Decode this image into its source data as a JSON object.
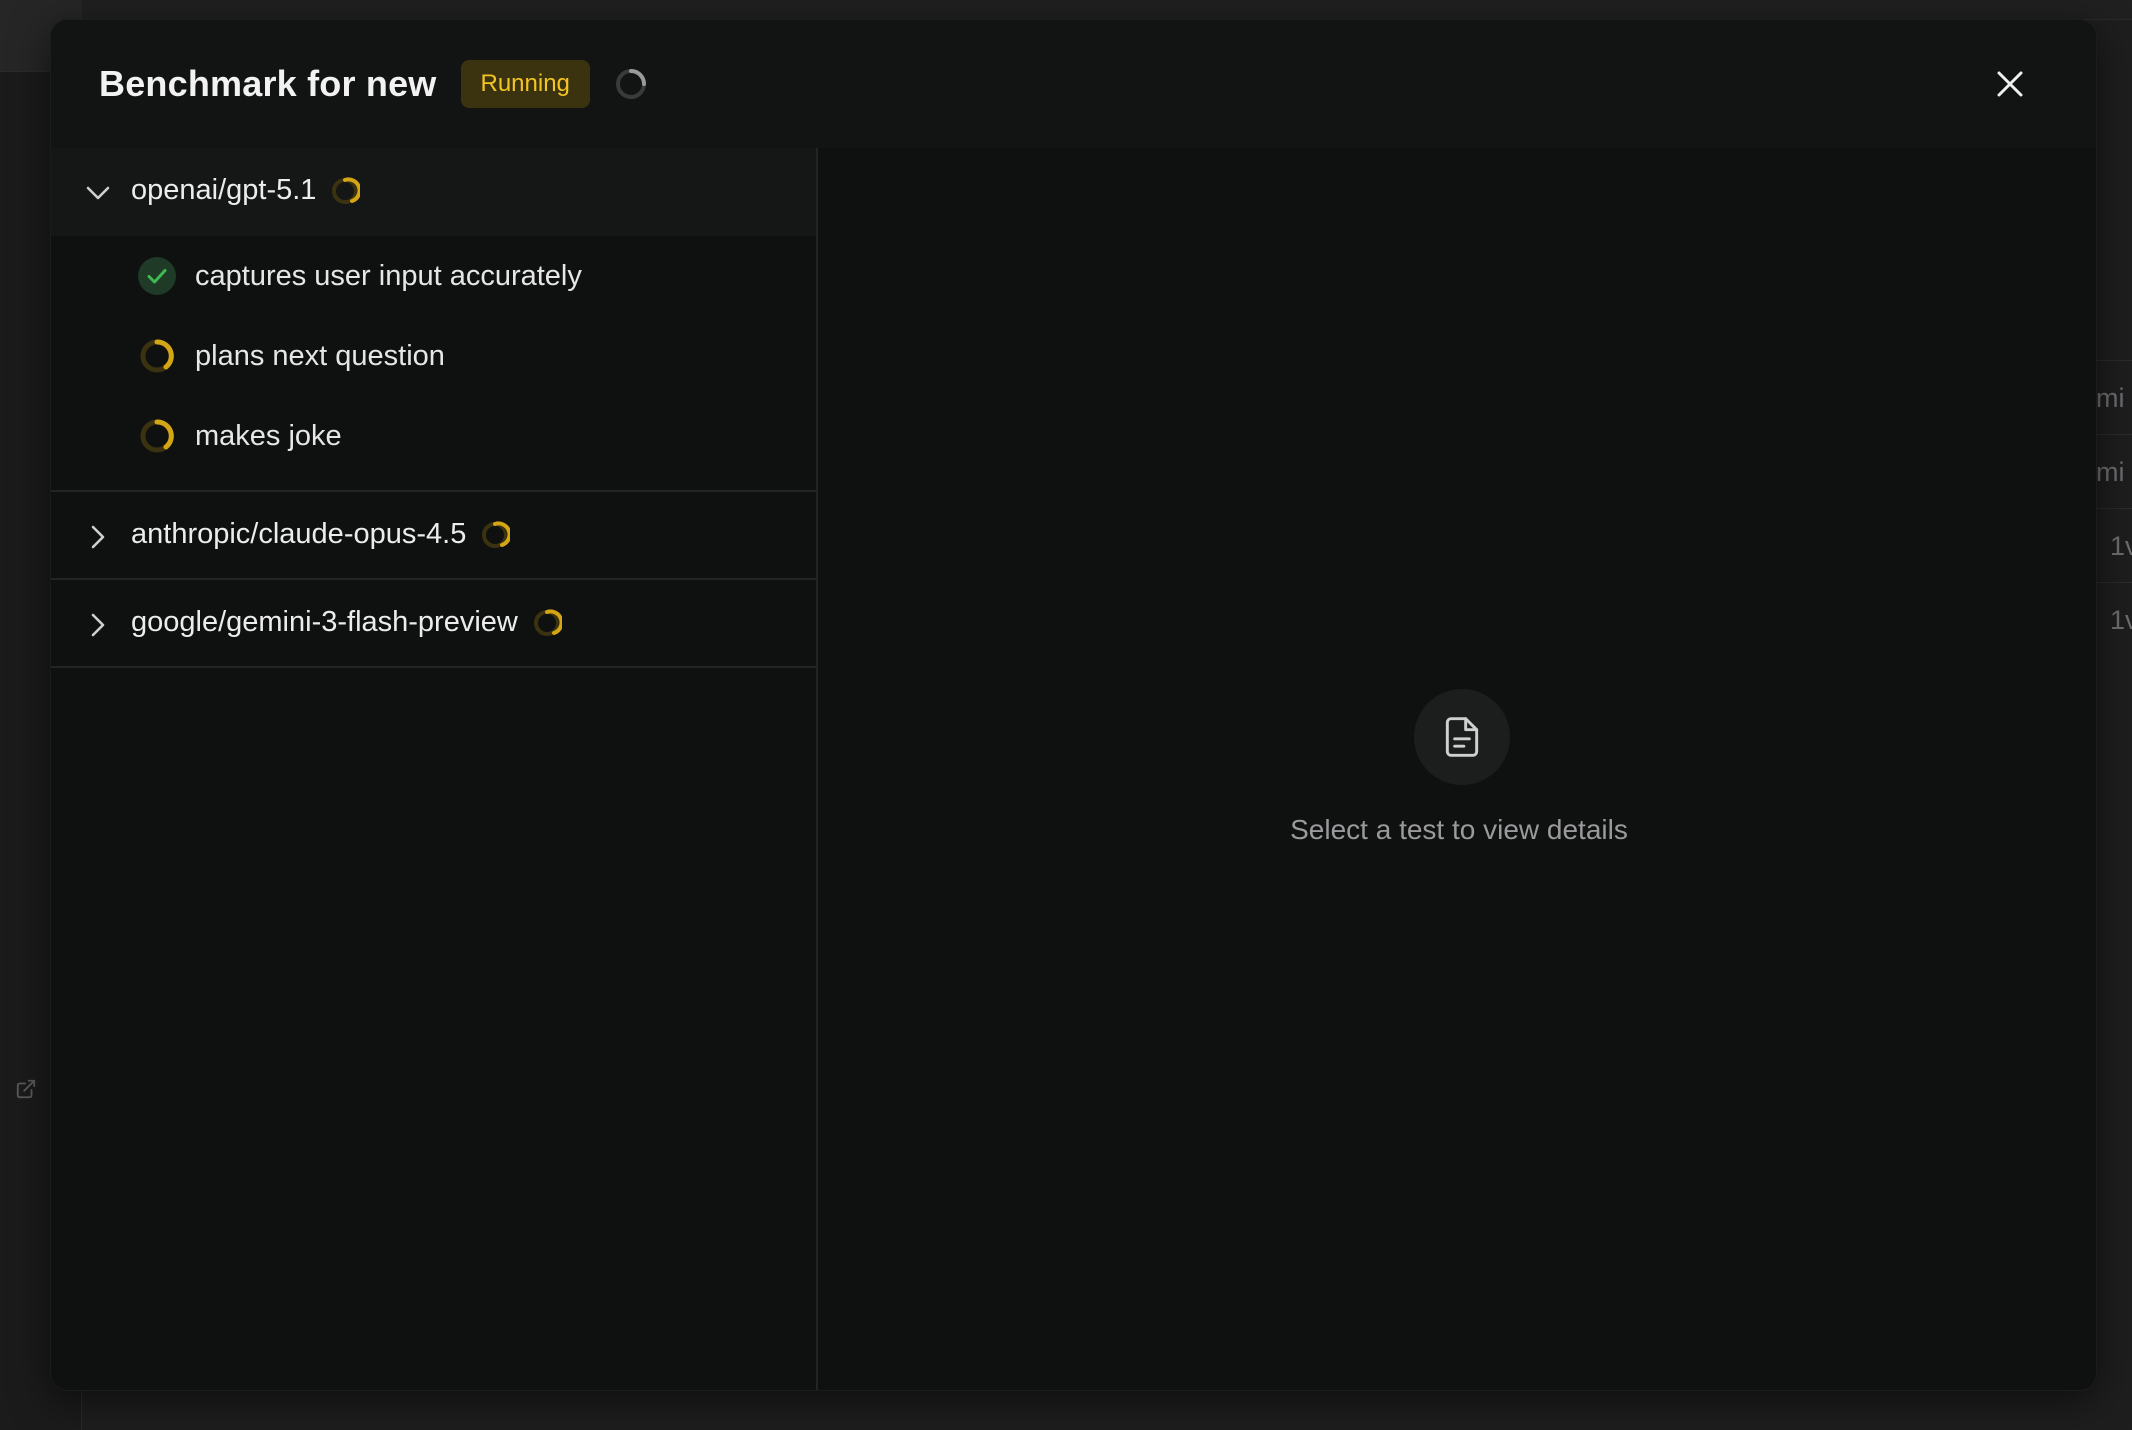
{
  "modal": {
    "title": "Benchmark for new",
    "status_badge": "Running",
    "close_icon": "close-icon"
  },
  "models": [
    {
      "name": "openai/gpt-5.1",
      "expanded": true,
      "status": "running",
      "tests": [
        {
          "label": "captures user input accurately",
          "status": "passed"
        },
        {
          "label": "plans next question",
          "status": "running"
        },
        {
          "label": "makes joke",
          "status": "running"
        }
      ]
    },
    {
      "name": "anthropic/claude-opus-4.5",
      "expanded": false,
      "status": "running",
      "tests": []
    },
    {
      "name": "google/gemini-3-flash-preview",
      "expanded": false,
      "status": "running",
      "tests": []
    }
  ],
  "detail": {
    "empty_icon": "document-icon",
    "empty_message": "Select a test to view details"
  },
  "background": {
    "row_fragments": [
      "mi",
      "mi",
      "1v",
      "1v"
    ],
    "external_link_icon": "external-link-icon"
  },
  "colors": {
    "accent_running": "#f3c524",
    "badge_bg": "#3b3210",
    "passed_green": "#3fb950",
    "modal_bg": "#0f1010"
  }
}
